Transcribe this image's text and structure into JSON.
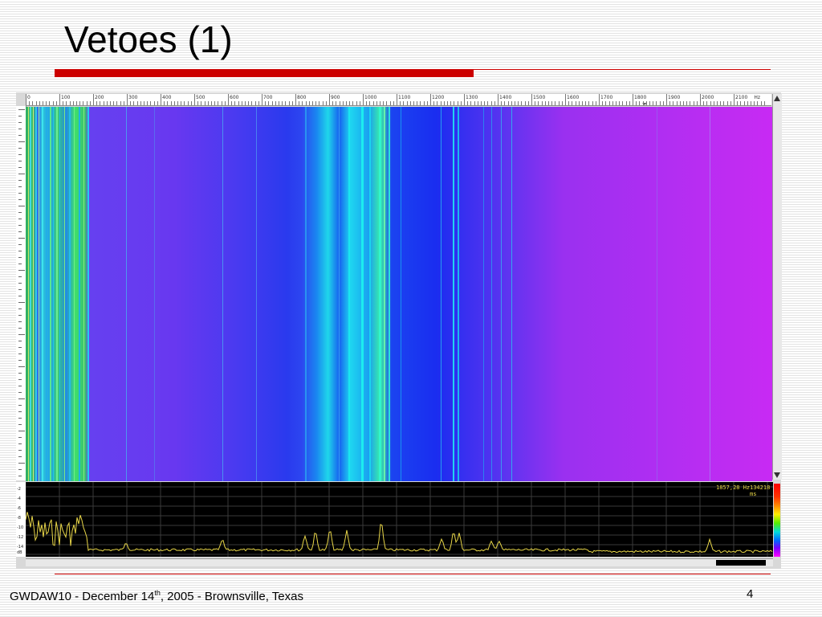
{
  "slide": {
    "title": "Vetoes (1)",
    "footer": {
      "pre": "GWDAW10 - December 14",
      "sup": "th",
      "post": ", 2005 - Brownsville, Texas"
    },
    "page_number": "4"
  },
  "spectrogram": {
    "x_ticks": [
      "0",
      "100",
      "200",
      "300",
      "400",
      "500",
      "600",
      "700",
      "800",
      "900",
      "1000",
      "1100",
      "1200",
      "1300",
      "1400",
      "1500",
      "1600",
      "1700",
      "1800",
      "1900",
      "2000",
      "2100"
    ],
    "x_unit": "Hz",
    "y_ticks": [
      "-2",
      "-4",
      "-6",
      "-8",
      "-10",
      "-12",
      "-14"
    ],
    "y_unit": "dB",
    "readout_freq": "1857,28 Hz",
    "readout_time": "134218 ms",
    "colors": {
      "low": "#c82af4",
      "mid": "#2a3aee",
      "high": "#1fd7ea",
      "trace": "#e8d648",
      "accent": "#cc0000"
    }
  }
}
